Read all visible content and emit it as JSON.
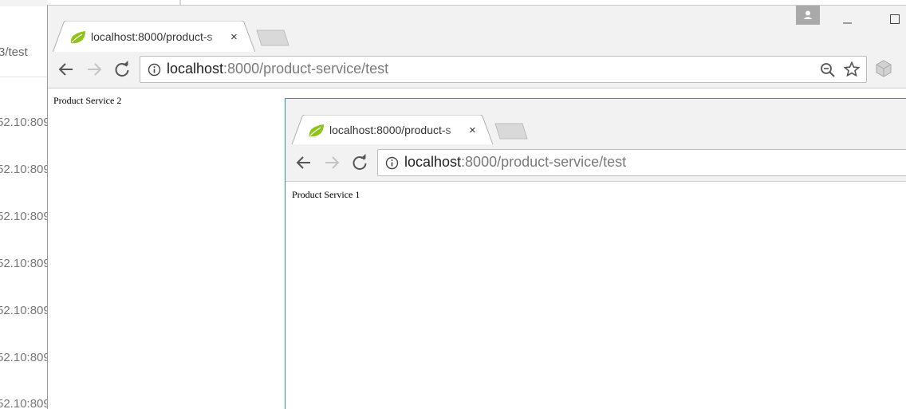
{
  "background_app": {
    "path_text": "3/test",
    "rows": [
      "52.10:809",
      "52.10:809",
      "52.10:809",
      "52.10:809",
      "52.10:809",
      "52.10:809",
      "52.10:809"
    ]
  },
  "window_back": {
    "tab": {
      "title": "localhost:8000/product-s",
      "close": "×"
    },
    "address": {
      "host": "localhost",
      "rest": ":8000/product-service/test"
    },
    "page_text": "Product Service 2"
  },
  "window_front": {
    "tab": {
      "title": "localhost:8000/product-s",
      "close": "×"
    },
    "address": {
      "host": "localhost",
      "rest": ":8000/product-service/test"
    },
    "page_text": "Product Service 1"
  },
  "colors": {
    "chrome": "#f2f2f2",
    "favicon_green": "#8fc21a",
    "profile_button": "#a9a9a9",
    "front_window_border": "#2f8fd5"
  }
}
